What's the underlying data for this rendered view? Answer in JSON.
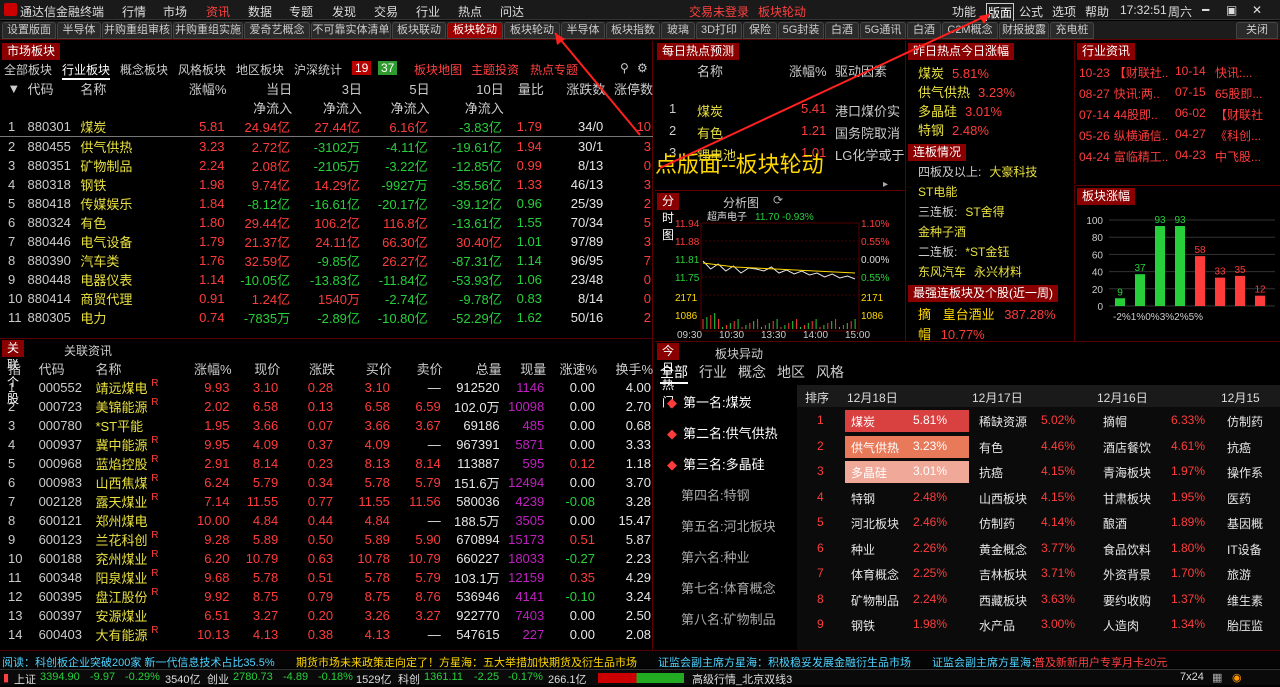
{
  "app": {
    "title": "通达信金融终端",
    "menus": [
      "行情",
      "市场",
      "资讯",
      "数据",
      "专题",
      "发现",
      "交易",
      "行业",
      "热点",
      "问达"
    ],
    "alert": "交易未登录",
    "alert2": "板块轮动",
    "right_menus": [
      "功能",
      "版面",
      "公式",
      "选项",
      "帮助"
    ],
    "time": "17:32:51",
    "weekday": "周六"
  },
  "tabs": [
    "设置版面",
    "半导体",
    "并购重组审核",
    "并购重组实施",
    "爱奇艺概念",
    "不可靠实体清单",
    "板块联动",
    "板块轮动",
    "板块轮动",
    "半导体",
    "板块指数",
    "玻璃",
    "3D打印",
    "保险",
    "5G封装",
    "白酒",
    "5G通讯",
    "白酒",
    "C2M概念",
    "财报披露",
    "充电桩",
    "关闭"
  ],
  "market": {
    "title": "市场板块",
    "subtabs": [
      "全部板块",
      "行业板块",
      "概念板块",
      "风格板块",
      "地区板块",
      "沪深统计"
    ],
    "counts": [
      "19",
      "37"
    ],
    "links": [
      "板块地图",
      "主题投资",
      "热点专题"
    ],
    "headers": [
      "代码",
      "名称",
      "涨幅%",
      "当日",
      "3日",
      "5日",
      "10日",
      "量比",
      "涨跌数",
      "涨停数"
    ],
    "subheaders": [
      "净流入",
      "净流入",
      "净流入",
      "净流入"
    ],
    "rows": [
      [
        "1",
        "880301",
        "煤炭",
        "5.81",
        "24.94亿",
        "27.44亿",
        "6.16亿",
        "-3.83亿",
        "1.79",
        "34/0",
        "10"
      ],
      [
        "2",
        "880455",
        "供气供热",
        "3.23",
        "2.72亿",
        "-3102万",
        "-4.11亿",
        "-19.61亿",
        "1.94",
        "30/1",
        "3"
      ],
      [
        "3",
        "880351",
        "矿物制品",
        "2.24",
        "2.08亿",
        "-2105万",
        "-3.22亿",
        "-12.85亿",
        "0.99",
        "8/13",
        "0"
      ],
      [
        "4",
        "880318",
        "钢铁",
        "1.98",
        "9.74亿",
        "14.29亿",
        "-9927万",
        "-35.56亿",
        "1.33",
        "46/13",
        "3"
      ],
      [
        "5",
        "880418",
        "传媒娱乐",
        "1.84",
        "-8.12亿",
        "-16.61亿",
        "-20.17亿",
        "-39.12亿",
        "0.96",
        "25/39",
        "2"
      ],
      [
        "6",
        "880324",
        "有色",
        "1.80",
        "29.44亿",
        "106.2亿",
        "116.8亿",
        "-13.61亿",
        "1.55",
        "70/34",
        "5"
      ],
      [
        "7",
        "880446",
        "电气设备",
        "1.79",
        "21.37亿",
        "24.11亿",
        "66.30亿",
        "30.40亿",
        "1.01",
        "97/89",
        "3"
      ],
      [
        "8",
        "880390",
        "汽车类",
        "1.76",
        "32.59亿",
        "-9.85亿",
        "26.27亿",
        "-87.31亿",
        "1.14",
        "96/95",
        "7"
      ],
      [
        "9",
        "880448",
        "电器仪表",
        "1.14",
        "-10.05亿",
        "-13.83亿",
        "-11.84亿",
        "-53.93亿",
        "1.06",
        "23/48",
        "0"
      ],
      [
        "10",
        "880414",
        "商贸代理",
        "0.91",
        "1.24亿",
        "1540万",
        "-2.74亿",
        "-9.78亿",
        "0.83",
        "8/14",
        "0"
      ],
      [
        "11",
        "880305",
        "电力",
        "0.74",
        "-7835万",
        "-2.89亿",
        "-10.80亿",
        "-52.29亿",
        "1.62",
        "50/16",
        "2"
      ]
    ]
  },
  "stocks": {
    "tabs": [
      "关联个股",
      "关联资讯"
    ],
    "headers": [
      "指",
      "代码",
      "名称",
      "涨幅%",
      "现价",
      "涨跌",
      "买价",
      "卖价",
      "总量",
      "现量",
      "涨速%",
      "换手%"
    ],
    "rows": [
      [
        "1",
        "000552",
        "靖远煤电",
        "R",
        "9.93",
        "3.10",
        "0.28",
        "3.10",
        "—",
        "912520",
        "1146",
        "0.00",
        "4.00"
      ],
      [
        "2",
        "000723",
        "美锦能源",
        "R",
        "2.02",
        "6.58",
        "0.13",
        "6.58",
        "6.59",
        "102.0万",
        "10098",
        "0.00",
        "2.70"
      ],
      [
        "3",
        "000780",
        "*ST平能",
        "",
        "1.95",
        "3.66",
        "0.07",
        "3.66",
        "3.67",
        "69186",
        "485",
        "0.00",
        "0.68"
      ],
      [
        "4",
        "000937",
        "冀中能源",
        "R",
        "9.95",
        "4.09",
        "0.37",
        "4.09",
        "—",
        "967391",
        "5871",
        "0.00",
        "3.33"
      ],
      [
        "5",
        "000968",
        "蓝焰控股",
        "R",
        "2.91",
        "8.14",
        "0.23",
        "8.13",
        "8.14",
        "113887",
        "595",
        "0.12",
        "1.18"
      ],
      [
        "6",
        "000983",
        "山西焦煤",
        "R",
        "6.24",
        "5.79",
        "0.34",
        "5.78",
        "5.79",
        "151.6万",
        "12494",
        "0.00",
        "3.70"
      ],
      [
        "7",
        "002128",
        "露天煤业",
        "R",
        "7.14",
        "11.55",
        "0.77",
        "11.55",
        "11.56",
        "580036",
        "4239",
        "-0.08",
        "3.28"
      ],
      [
        "8",
        "600121",
        "郑州煤电",
        "",
        "10.00",
        "4.84",
        "0.44",
        "4.84",
        "—",
        "188.5万",
        "3505",
        "0.00",
        "15.47"
      ],
      [
        "9",
        "600123",
        "兰花科创",
        "R",
        "9.28",
        "5.89",
        "0.50",
        "5.89",
        "5.90",
        "670894",
        "15173",
        "0.51",
        "5.87"
      ],
      [
        "10",
        "600188",
        "兖州煤业",
        "R",
        "6.20",
        "10.79",
        "0.63",
        "10.78",
        "10.79",
        "660227",
        "18033",
        "-0.27",
        "2.23"
      ],
      [
        "11",
        "600348",
        "阳泉煤业",
        "R",
        "9.68",
        "5.78",
        "0.51",
        "5.78",
        "5.79",
        "103.1万",
        "12159",
        "0.35",
        "4.29"
      ],
      [
        "12",
        "600395",
        "盘江股份",
        "R",
        "9.92",
        "8.75",
        "0.79",
        "8.75",
        "8.76",
        "536946",
        "4141",
        "-0.10",
        "3.24"
      ],
      [
        "13",
        "600397",
        "安源煤业",
        "",
        "6.51",
        "3.27",
        "0.20",
        "3.26",
        "3.27",
        "922770",
        "7403",
        "0.00",
        "2.50"
      ],
      [
        "14",
        "600403",
        "大有能源",
        "R",
        "10.13",
        "4.13",
        "0.38",
        "4.13",
        "—",
        "547615",
        "227",
        "0.00",
        "2.08"
      ]
    ]
  },
  "forecast": {
    "title": "每日热点预测",
    "headers": [
      "名称",
      "涨幅%",
      "驱动因素"
    ],
    "rows": [
      [
        "1",
        "煤炭",
        "5.41",
        "港口煤价实"
      ],
      [
        "2",
        "有色",
        "1.21",
        "国务院取消"
      ],
      [
        "3",
        "锂电池",
        "1.01",
        "LG化学或于"
      ]
    ]
  },
  "annotation": "点版面--板块轮动",
  "hot": {
    "title": "昨日热点今日涨幅",
    "items": [
      [
        "煤炭",
        "5.81%"
      ],
      [
        "供气供热",
        "3.23%"
      ],
      [
        "多晶硅",
        "3.01%"
      ],
      [
        "特钢",
        "2.48%"
      ]
    ]
  },
  "board": {
    "title": "连板情况",
    "rows": [
      [
        "四板及以上:",
        "大豪科技"
      ],
      [
        "ST电能",
        ""
      ],
      [
        "三连板:",
        "ST舍得"
      ],
      [
        "金种子酒",
        ""
      ],
      [
        "二连板:",
        "*ST金钰"
      ],
      [
        "东风汽车",
        "永兴材料"
      ]
    ]
  },
  "strongest": {
    "title": "最强连板块及个股(近一周)",
    "items": [
      [
        "摘",
        "皇台酒业",
        "387.28%"
      ],
      [
        "帽",
        "10.77%",
        ""
      ]
    ]
  },
  "news": {
    "title": "行业资讯",
    "rows": [
      [
        "10-23",
        "【财联社..",
        "10-14",
        "快讯:..."
      ],
      [
        "08-27",
        "快讯:两..",
        "07-15",
        "65股即..."
      ],
      [
        "07-14",
        "44股即..",
        "06-02",
        "【财联社"
      ],
      [
        "05-26",
        "纵横通信..",
        "04-27",
        "《科创..."
      ],
      [
        "04-24",
        "富临精工..",
        "04-23",
        "中飞股..."
      ]
    ]
  },
  "rise": {
    "title": "板块涨幅"
  },
  "chart_data": [
    {
      "type": "line",
      "title": "超声电子",
      "price": "11.70",
      "change": "-0.93%",
      "ylim": [
        11.7,
        11.94
      ],
      "yticks": [
        "11.94",
        "11.88",
        "11.81",
        "11.75",
        "2171",
        "1086"
      ],
      "pct": [
        "1.10%",
        "0.55%",
        "0.00%",
        "0.55%",
        "2171",
        "1086"
      ],
      "xticks": [
        "09:30",
        "10:30",
        "13:30",
        "14:00",
        "15:00"
      ]
    },
    {
      "type": "bar",
      "title": "板块涨幅",
      "categories": [
        "-2%",
        "1%",
        "0%",
        "3%",
        "2%",
        "5%",
        "..."
      ],
      "values": [
        9,
        37,
        93,
        93,
        58,
        33,
        35,
        12
      ],
      "ylim": [
        0,
        100
      ],
      "yticks": [
        "100",
        "80",
        "60",
        "40",
        "20",
        "0"
      ],
      "xlabels": [
        "-2%",
        "1%",
        "0%",
        "3%",
        "2%",
        "5%"
      ]
    }
  ],
  "chart_tabs": [
    "分时图",
    "分析图"
  ],
  "today": {
    "tabs": [
      "今日热门",
      "板块异动"
    ],
    "filters": [
      "全部",
      "行业",
      "概念",
      "地区",
      "风格"
    ],
    "rank": [
      "第一名:煤炭",
      "第二名:供气供热",
      "第三名:多晶硅",
      "第四名:特钢",
      "第五名:河北板块",
      "第六名:种业",
      "第七名:体育概念",
      "第八名:矿物制品"
    ],
    "dates": [
      "排序",
      "12月18日",
      "12月17日",
      "12月16日",
      "12月15"
    ],
    "grid": [
      [
        "1",
        "煤炭",
        "5.81%",
        "稀缺资源",
        "5.02%",
        "摘帽",
        "6.33%",
        "仿制药"
      ],
      [
        "2",
        "供气供热",
        "3.23%",
        "有色",
        "4.46%",
        "酒店餐饮",
        "4.61%",
        "抗癌"
      ],
      [
        "3",
        "多晶硅",
        "3.01%",
        "抗癌",
        "4.15%",
        "青海板块",
        "1.97%",
        "操作系"
      ],
      [
        "4",
        "特钢",
        "2.48%",
        "山西板块",
        "4.15%",
        "甘肃板块",
        "1.95%",
        "医药"
      ],
      [
        "5",
        "河北板块",
        "2.46%",
        "仿制药",
        "4.14%",
        "酿酒",
        "1.89%",
        "基因概"
      ],
      [
        "6",
        "种业",
        "2.26%",
        "黄金概念",
        "3.77%",
        "食品饮料",
        "1.80%",
        "IT设备"
      ],
      [
        "7",
        "体育概念",
        "2.25%",
        "吉林板块",
        "3.71%",
        "外资背景",
        "1.70%",
        "旅游"
      ],
      [
        "8",
        "矿物制品",
        "2.24%",
        "西藏板块",
        "3.63%",
        "要约收购",
        "1.37%",
        "维生素"
      ],
      [
        "9",
        "钢铁",
        "1.98%",
        "水产品",
        "3.00%",
        "人造肉",
        "1.34%",
        "胎压监"
      ]
    ]
  },
  "ticker": [
    "阅读：科创板企业突破200家 新一代信息技术占比35.5%",
    "期货市场未来政策走向定了！方星海：五大举措加快期货及衍生品市场",
    "证监会副主席方星海：积极稳妥发展金融衍生品市场",
    "证监会副主席方星海：",
    "普及新新用户专享月卡20元"
  ],
  "status": {
    "sh": "上证",
    "sh_v": "3394.90",
    "sh_c": "-9.97",
    "sh_p": "-0.29%",
    "sh_a": "3540亿",
    "cy": "创业",
    "cy_v": "2780.73",
    "cy_c": "-4.89",
    "cy_p": "-0.18%",
    "cy_a": "1529亿",
    "kc": "科创",
    "kc_v": "1361.11",
    "kc_c": "-2.25",
    "kc_p": "-0.17%",
    "kc_a": "266.1亿",
    "src": "高级行情_北京双线3",
    "right": "7x24"
  }
}
